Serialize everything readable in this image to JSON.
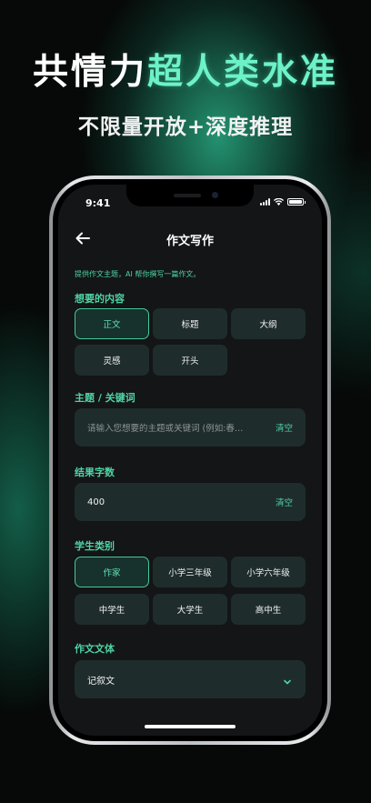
{
  "promo": {
    "headline_white": "共情力",
    "headline_green": "超人类水准",
    "subheadline": "不限量开放+深度推理",
    "accent_color": "#6df2c6"
  },
  "status_bar": {
    "time": "9:41"
  },
  "nav": {
    "title": "作文写作",
    "back_icon": "arrow-left-icon"
  },
  "hint": "提供作文主题，AI 帮你撰写一篇作文。",
  "content_section": {
    "label": "想要的内容",
    "options": [
      {
        "label": "正文",
        "selected": true
      },
      {
        "label": "标题",
        "selected": false
      },
      {
        "label": "大纲",
        "selected": false
      },
      {
        "label": "灵感",
        "selected": false
      },
      {
        "label": "开头",
        "selected": false
      }
    ]
  },
  "topic_section": {
    "label": "主题 / 关键词",
    "placeholder": "请输入您想要的主题或关键词 (例如:春…",
    "clear_label": "清空"
  },
  "wordcount_section": {
    "label": "结果字数",
    "value": "400",
    "clear_label": "清空"
  },
  "student_section": {
    "label": "学生类别",
    "options": [
      {
        "label": "作家",
        "selected": true
      },
      {
        "label": "小学三年级",
        "selected": false
      },
      {
        "label": "小学六年级",
        "selected": false
      },
      {
        "label": "中学生",
        "selected": false
      },
      {
        "label": "大学生",
        "selected": false
      },
      {
        "label": "高中生",
        "selected": false
      }
    ]
  },
  "style_section": {
    "label": "作文文体",
    "selected": "记叙文",
    "dropdown_icon": "chevron-down-icon"
  },
  "colors": {
    "accent": "#4fd3a3",
    "chip_bg": "#1f2c2c",
    "screen_bg": "#131517"
  }
}
